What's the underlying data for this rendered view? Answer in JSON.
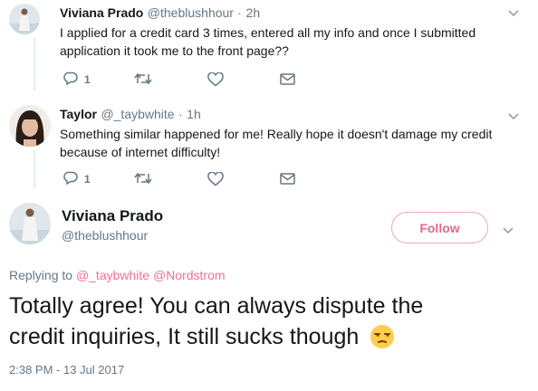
{
  "tweet1": {
    "name": "Viviana Prado",
    "handle": "@theblushhour",
    "time": "2h",
    "text_line1": "I applied for a credit card 3 times, entered all my info and once I submitted",
    "text_line2": "application it took me to the front page??",
    "reply_count": "1"
  },
  "tweet2": {
    "name": "Taylor",
    "handle": "@_taybwhite",
    "time": "1h",
    "text_line1": "Something similar happened for me! Really hope it doesn't damage my credit",
    "text_line2": "because of internet difficulty!",
    "reply_count": "1"
  },
  "main": {
    "name": "Viviana Prado",
    "handle": "@theblushhour",
    "follow_label": "Follow",
    "replying_to_label": "Replying to",
    "mention1": "@_taybwhite",
    "mention2": "@Nordstrom",
    "text_line1": "Totally agree! You can always dispute the",
    "text_line2": "credit inquiries, It still sucks though",
    "emoji": "unamused-face",
    "timestamp": "2:38 PM - 13 Jul 2017"
  },
  "colors": {
    "accent": "#e5678a",
    "mention": "#f07090",
    "secondary_text": "#657786"
  }
}
